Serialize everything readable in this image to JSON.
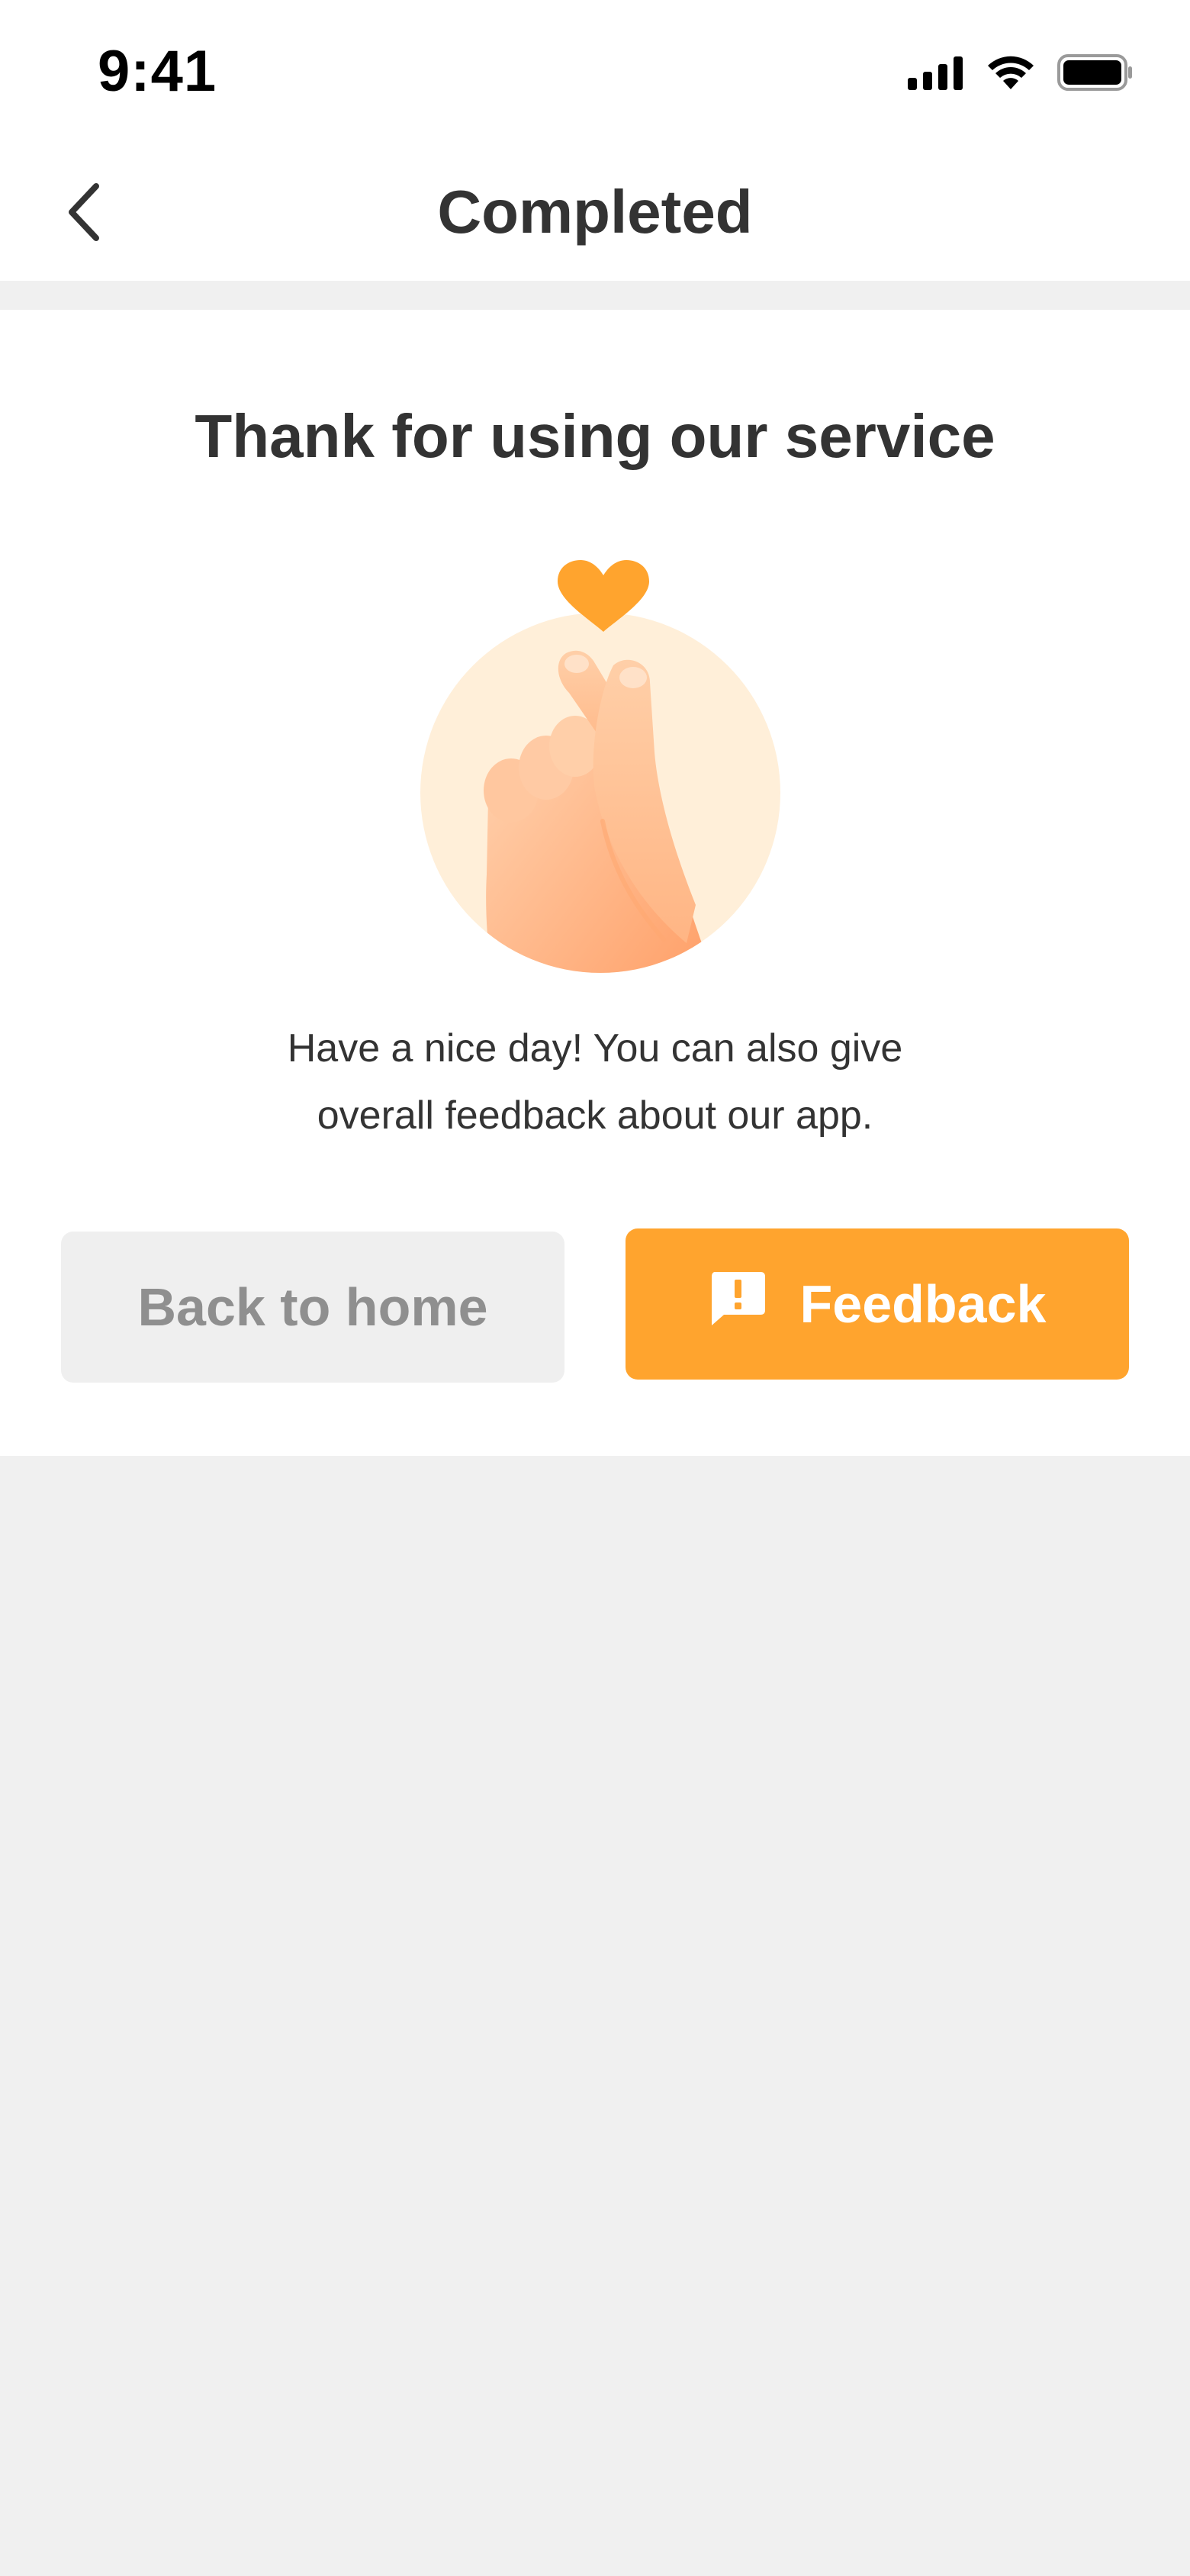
{
  "status_bar": {
    "time": "9:41",
    "icons": [
      "signal-icon",
      "wifi-icon",
      "battery-icon"
    ]
  },
  "nav": {
    "back_icon": "chevron-left-icon",
    "title": "Completed"
  },
  "card": {
    "title": "Thank for using our service",
    "illustration": "finger-heart-hand-illustration",
    "message": "Have a nice day! You can also give overall feedback about our app."
  },
  "buttons": {
    "home_label": "Back to home",
    "feedback_label": "Feedback",
    "feedback_icon": "feedback-alert-icon"
  },
  "colors": {
    "accent": "#ffa42e",
    "text": "#333333",
    "secondary_button_bg": "#efefef",
    "secondary_button_text": "#8f8f8f",
    "illustration_circle": "#ffefd9"
  }
}
